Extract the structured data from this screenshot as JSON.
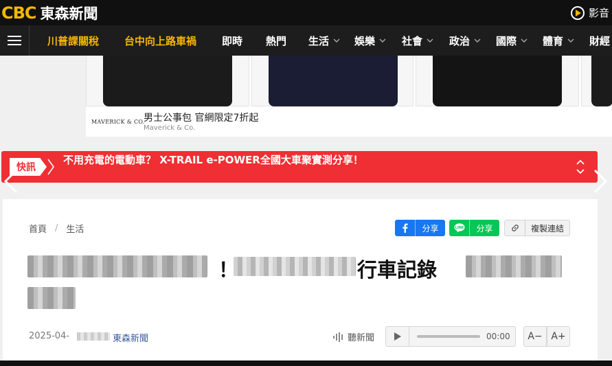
{
  "brand": {
    "mark": "CBC",
    "name": "東森新聞"
  },
  "topbar": {
    "video_label": "影音"
  },
  "nav": {
    "items": [
      {
        "label": "川普課關稅",
        "hot": true,
        "chevron": false
      },
      {
        "label": "台中向上路車禍",
        "hot": true,
        "chevron": false
      },
      {
        "label": "即時",
        "hot": false,
        "chevron": false
      },
      {
        "label": "熱門",
        "hot": false,
        "chevron": false
      },
      {
        "label": "生活",
        "hot": false,
        "chevron": true
      },
      {
        "label": "娛樂",
        "hot": false,
        "chevron": true
      },
      {
        "label": "社會",
        "hot": false,
        "chevron": true
      },
      {
        "label": "政治",
        "hot": false,
        "chevron": true
      },
      {
        "label": "國際",
        "hot": false,
        "chevron": true
      },
      {
        "label": "體育",
        "hot": false,
        "chevron": true
      },
      {
        "label": "財經",
        "hot": false,
        "chevron": false
      }
    ]
  },
  "ad": {
    "brand": "MAVERICK & CO.",
    "title": "男士公事包 官網限定7折起",
    "source": "Maverick & Co."
  },
  "breaking": {
    "tag": "快訊",
    "text": "不用充電的電動車？ X-TRAIL e-POWER全國大車聚實測分享！"
  },
  "article": {
    "breadcrumb": [
      "首頁",
      "生活"
    ],
    "share": {
      "facebook": "分享",
      "line": "分享",
      "copy": "複製連結"
    },
    "headline_visible": "行車記錄",
    "headline_excl": "！",
    "date": "2025-04-",
    "source": "東森新聞",
    "listen_label": "聽新聞",
    "time": "00:00",
    "font_small": "A−",
    "font_large": "A+"
  },
  "colors": {
    "brand_yellow": "#f6b700",
    "breaking_red": "#ef2f33",
    "facebook": "#1877f2",
    "line": "#06c755"
  }
}
